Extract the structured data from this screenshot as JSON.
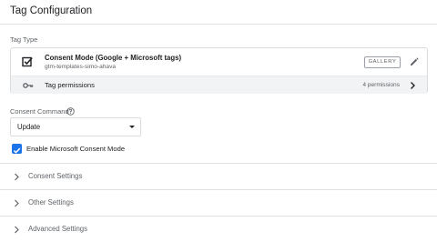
{
  "header": {
    "title": "Tag Configuration"
  },
  "tag_type": {
    "label": "Tag Type",
    "name": "Consent Mode (Google + Microsoft tags)",
    "source": "gtm-templates-simo-ahava",
    "gallery_button": "GALLERY",
    "permissions_label": "Tag permissions",
    "permissions_count": "4 permissions"
  },
  "consent_command": {
    "label": "Consent Command",
    "selected": "Update"
  },
  "microsoft_consent": {
    "label": "Enable Microsoft Consent Mode",
    "checked": true
  },
  "sections": [
    {
      "label": "Consent Settings"
    },
    {
      "label": "Other Settings"
    },
    {
      "label": "Advanced Settings"
    }
  ],
  "colors": {
    "accent": "#1a73e8",
    "border": "#dadce0",
    "muted_text": "#5f6368"
  },
  "icons": [
    "check-box-icon",
    "pencil-icon",
    "key-icon",
    "chevron-right-icon",
    "help-icon",
    "dropdown-caret-icon",
    "checkmark-icon"
  ]
}
